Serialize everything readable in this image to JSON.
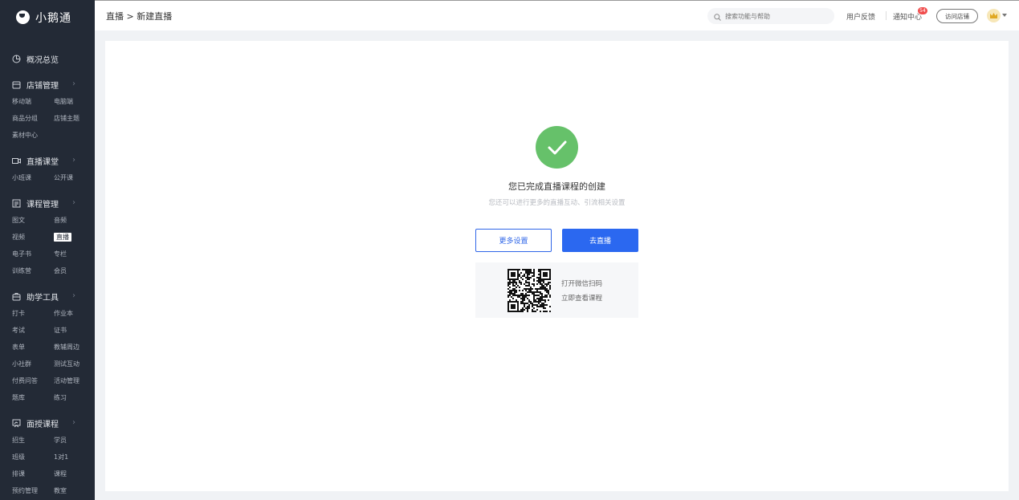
{
  "app": {
    "name": "小鹅通"
  },
  "sidebar": {
    "overview": "概况总览",
    "groups": [
      {
        "title": "店铺管理",
        "icon": "store-icon",
        "items": [
          "移动端",
          "电脑端",
          "商品分组",
          "店铺主题",
          "素材中心"
        ]
      },
      {
        "title": "直播课堂",
        "icon": "live-room-icon",
        "items": [
          "小班课",
          "公开课"
        ]
      },
      {
        "title": "课程管理",
        "icon": "course-list-icon",
        "items": [
          "图文",
          "音频",
          "视频",
          "直播",
          "电子书",
          "专栏",
          "训练营",
          "会员"
        ]
      },
      {
        "title": "助学工具",
        "icon": "toolbox-icon",
        "items": [
          "打卡",
          "作业本",
          "考试",
          "证书",
          "表单",
          "教辅周边",
          "小社群",
          "测试互动",
          "付费问答",
          "活动管理",
          "题库",
          "练习"
        ]
      },
      {
        "title": "面授课程",
        "icon": "classroom-icon",
        "items": [
          "招生",
          "学员",
          "班级",
          "1对1",
          "排课",
          "课程",
          "预约管理",
          "教室"
        ]
      }
    ],
    "active_item": "直播"
  },
  "header": {
    "breadcrumb": "直播 > 新建直播",
    "search_placeholder": "搜索功能与帮助",
    "feedback": "用户反馈",
    "notifications": "通知中心",
    "notification_count": "54",
    "visit_store": "访问店铺"
  },
  "main": {
    "title": "您已完成直播课程的创建",
    "subtitle": "您还可以进行更多的直播互动、引流相关设置",
    "more_settings": "更多设置",
    "go_live": "去直播",
    "qr_line1": "打开微信扫码",
    "qr_line2": "立即查看课程"
  },
  "colors": {
    "sidebar_bg": "#232a36",
    "primary": "#2b68f0",
    "success": "#66c16a",
    "badge": "#f04d4d"
  }
}
